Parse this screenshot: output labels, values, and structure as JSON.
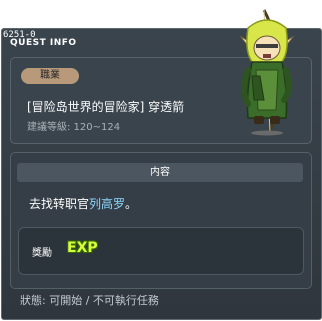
{
  "window": {
    "quest_id": "6251-0",
    "title": "QUEST INFO"
  },
  "job_section": {
    "badge": "職業",
    "quest_name": "[冒险岛世界的冒险家] 穿透箭",
    "level_requirement": "建議等級: 120~124"
  },
  "content_section": {
    "header": "内容",
    "instruction_prefix": "去找转职官",
    "npc_name": "列高罗",
    "instruction_suffix": "。",
    "npc_name_color": "#8fd8ff"
  },
  "reward_section": {
    "label": "獎勵",
    "reward_icon": "exp-icon"
  },
  "status": {
    "text": "狀態: 可開始 / 不可執行任務"
  },
  "npc": {
    "icon": "elf-archer-npc-sprite"
  }
}
